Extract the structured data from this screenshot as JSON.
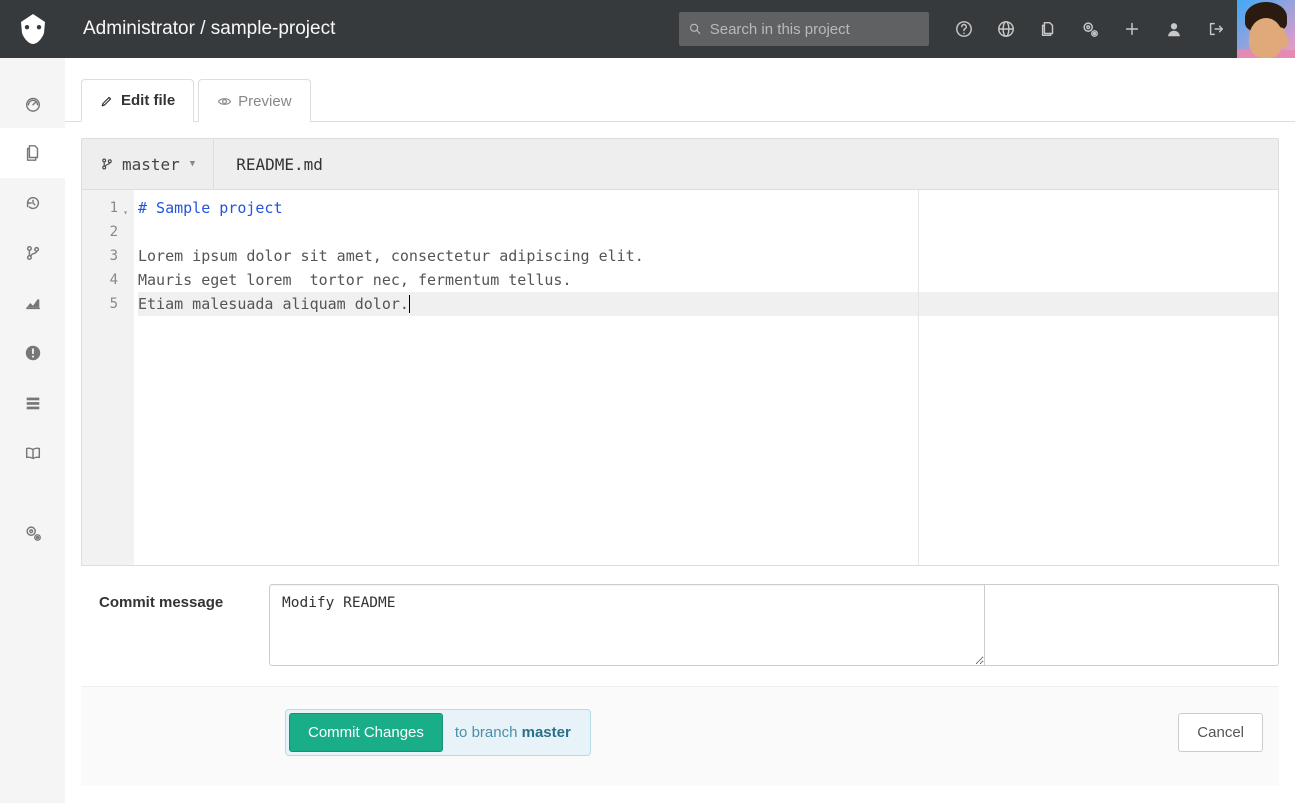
{
  "header": {
    "breadcrumb_owner": "Administrator",
    "breadcrumb_sep": " / ",
    "breadcrumb_project": "sample-project",
    "search_placeholder": "Search in this project"
  },
  "tabs": {
    "edit_label": "Edit file",
    "preview_label": "Preview"
  },
  "file": {
    "branch": "master",
    "filename": "README.md"
  },
  "editor": {
    "lines": {
      "l1": "# Sample project",
      "l2": "",
      "l3": "Lorem ipsum dolor sit amet, consectetur adipiscing elit.",
      "l4": "Mauris eget lorem  tortor nec, fermentum tellus.",
      "l5": "Etiam malesuada aliquam dolor."
    },
    "line_numbers": {
      "n1": "1",
      "n2": "2",
      "n3": "3",
      "n4": "4",
      "n5": "5"
    }
  },
  "commit": {
    "label": "Commit message",
    "message_value": "Modify README"
  },
  "actions": {
    "commit_button": "Commit Changes",
    "to_branch_prefix": "to branch ",
    "to_branch_name": "master",
    "cancel_button": "Cancel"
  }
}
